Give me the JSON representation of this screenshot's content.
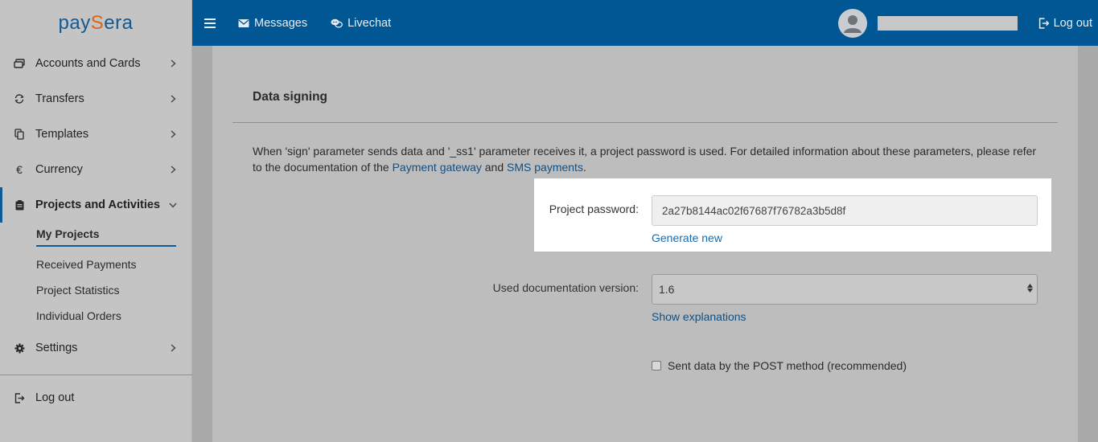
{
  "brand": {
    "logo_part1": "pay",
    "logo_part2": "S",
    "logo_part3": "era",
    "blue": "#125a94",
    "orange": "#d9661f"
  },
  "topbar": {
    "menu_icon": "hamburger-icon",
    "messages_label": "Messages",
    "livechat_label": "Livechat",
    "logout_label": "Log out",
    "background": "#005794"
  },
  "sidebar": {
    "items": [
      {
        "label": "Accounts and Cards",
        "icon": "cards-icon"
      },
      {
        "label": "Transfers",
        "icon": "transfer-icon"
      },
      {
        "label": "Templates",
        "icon": "copy-icon"
      },
      {
        "label": "Currency",
        "icon": "euro-icon"
      },
      {
        "label": "Projects and Activities",
        "icon": "clipboard-icon"
      }
    ],
    "sub_items": [
      {
        "label": "My Projects"
      },
      {
        "label": "Received Payments"
      },
      {
        "label": "Project Statistics"
      },
      {
        "label": "Individual Orders"
      }
    ],
    "settings_label": "Settings",
    "logout_label": "Log out"
  },
  "main": {
    "section_title": "Data signing",
    "description_part1": "When 'sign' parameter sends data and '_ss1' parameter receives it, a project password is used. For detailed information about these parameters, please refer to the documentation of the ",
    "payment_gateway_link": "Payment gateway",
    "description_and": " and ",
    "sms_link": "SMS payments",
    "description_end": ".",
    "password_label": "Project password:",
    "password_value": "2a27b8144ac02f67687f76782a3b5d8f",
    "generate_new_label": "Generate new",
    "doc_version_label": "Used documentation version:",
    "doc_version_value": "1.6",
    "show_explanations_label": "Show explanations",
    "post_method_label": "Sent data by the POST method (recommended)"
  }
}
